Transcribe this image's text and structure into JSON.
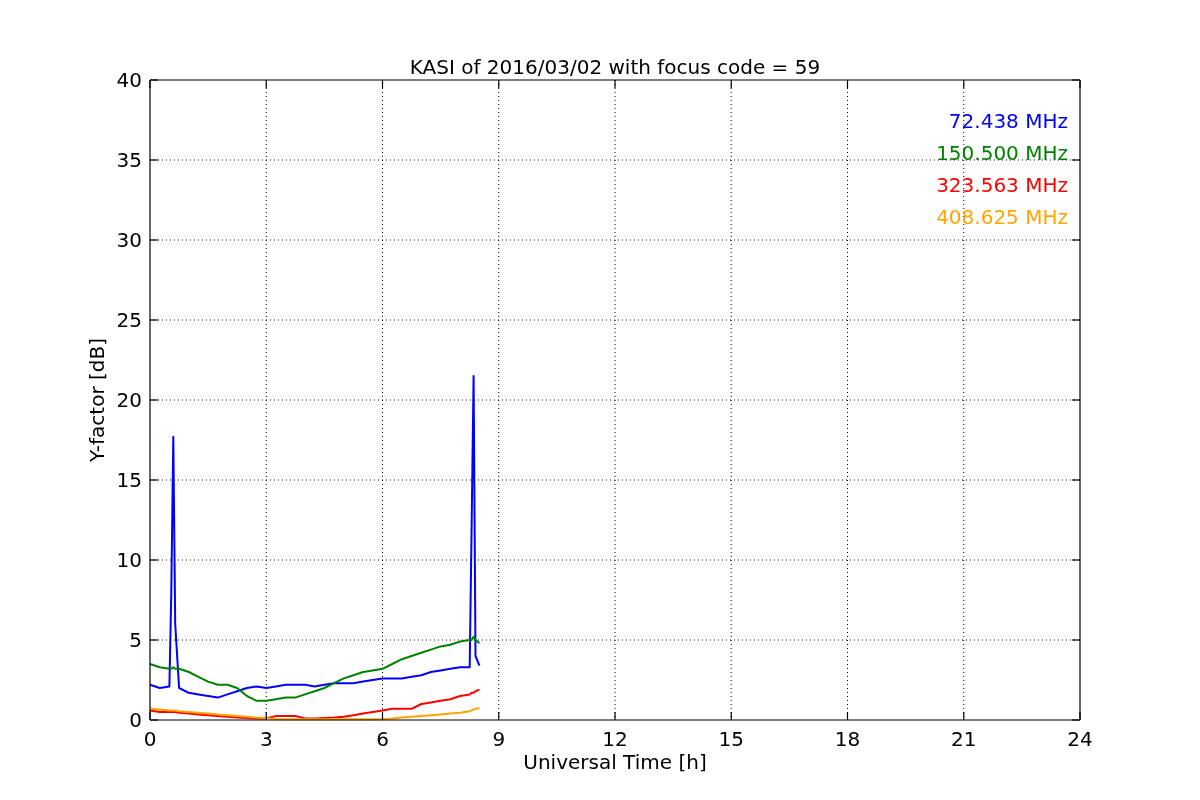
{
  "chart_data": {
    "type": "line",
    "title": "KASI of 2016/03/02 with focus code = 59",
    "xlabel": "Universal Time [h]",
    "ylabel": "Y-factor [dB]",
    "x": [
      0,
      0.25,
      0.5,
      0.55,
      0.6,
      0.65,
      0.75,
      1,
      1.25,
      1.5,
      1.75,
      2,
      2.25,
      2.5,
      2.75,
      3,
      3.25,
      3.5,
      3.75,
      4,
      4.25,
      4.5,
      4.75,
      5,
      5.25,
      5.5,
      5.75,
      6,
      6.25,
      6.5,
      6.75,
      7,
      7.25,
      7.5,
      7.75,
      8,
      8.25,
      8.3,
      8.35,
      8.4,
      8.5
    ],
    "series": [
      {
        "name": "72.438 MHz",
        "color": "#0000ff",
        "values": [
          2.2,
          2.0,
          2.1,
          8,
          17.7,
          6,
          2.0,
          1.7,
          1.6,
          1.5,
          1.4,
          1.6,
          1.8,
          2.0,
          2.1,
          2.0,
          2.1,
          2.2,
          2.2,
          2.2,
          2.1,
          2.2,
          2.3,
          2.3,
          2.3,
          2.4,
          2.5,
          2.6,
          2.6,
          2.6,
          2.7,
          2.8,
          3.0,
          3.1,
          3.2,
          3.3,
          3.3,
          12,
          21.5,
          4,
          3.4
        ]
      },
      {
        "name": "150.500 MHz",
        "color": "#008000",
        "values": [
          3.5,
          3.3,
          3.2,
          3.2,
          3.3,
          3.2,
          3.2,
          3.0,
          2.7,
          2.4,
          2.2,
          2.2,
          2.0,
          1.5,
          1.2,
          1.2,
          1.3,
          1.4,
          1.4,
          1.6,
          1.8,
          2.0,
          2.3,
          2.6,
          2.8,
          3.0,
          3.1,
          3.2,
          3.5,
          3.8,
          4.0,
          4.2,
          4.4,
          4.6,
          4.7,
          4.9,
          5.0,
          5.0,
          5.2,
          5.0,
          4.8
        ]
      },
      {
        "name": "323.563 MHz",
        "color": "#ff0000",
        "values": [
          0.6,
          0.5,
          0.5,
          0.5,
          0.5,
          0.5,
          0.45,
          0.4,
          0.35,
          0.3,
          0.25,
          0.2,
          0.15,
          0.12,
          0.1,
          0.1,
          0.25,
          0.25,
          0.25,
          0.1,
          0.1,
          0.12,
          0.15,
          0.2,
          0.3,
          0.4,
          0.5,
          0.6,
          0.7,
          0.7,
          0.7,
          1.0,
          1.1,
          1.2,
          1.3,
          1.5,
          1.6,
          1.7,
          1.7,
          1.8,
          1.9
        ]
      },
      {
        "name": "408.625 MHz",
        "color": "#ffa500",
        "values": [
          0.7,
          0.65,
          0.6,
          0.6,
          0.6,
          0.6,
          0.55,
          0.5,
          0.45,
          0.4,
          0.35,
          0.3,
          0.25,
          0.2,
          0.15,
          0.12,
          0.05,
          0.05,
          0.05,
          0.05,
          0.05,
          0.05,
          0.05,
          0.05,
          0.05,
          0.05,
          0.05,
          0.05,
          0.1,
          0.15,
          0.2,
          0.25,
          0.3,
          0.35,
          0.4,
          0.45,
          0.55,
          0.6,
          0.65,
          0.7,
          0.75
        ]
      }
    ],
    "xlim": [
      0,
      24
    ],
    "ylim": [
      0,
      40
    ],
    "grid": true,
    "xticks": [
      0,
      3,
      6,
      9,
      12,
      15,
      18,
      21,
      24
    ],
    "yticks": [
      0,
      5,
      10,
      15,
      20,
      25,
      30,
      35,
      40
    ]
  }
}
